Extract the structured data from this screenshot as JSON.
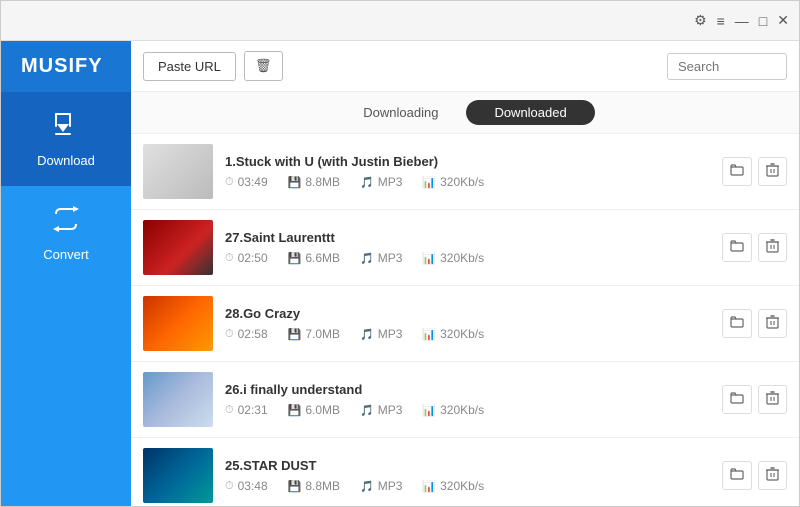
{
  "app": {
    "title": "MUSIFY"
  },
  "titlebar": {
    "settings_icon": "⚙",
    "menu_icon": "≡",
    "minimize_icon": "—",
    "maximize_icon": "□",
    "close_icon": "✕"
  },
  "toolbar": {
    "paste_url_label": "Paste URL",
    "delete_icon": "🗑",
    "search_placeholder": "Search"
  },
  "sidebar": {
    "items": [
      {
        "id": "download",
        "label": "Download",
        "icon": "⬇",
        "active": true
      },
      {
        "id": "convert",
        "label": "Convert",
        "icon": "🔄",
        "active": false
      }
    ]
  },
  "tabs": [
    {
      "id": "downloading",
      "label": "Downloading",
      "active": false
    },
    {
      "id": "downloaded",
      "label": "Downloaded",
      "active": true
    }
  ],
  "songs": [
    {
      "id": 1,
      "title": "1.Stuck with U (with Justin Bieber)",
      "duration": "03:49",
      "size": "8.8MB",
      "format": "MP3",
      "bitrate": "320Kb/s",
      "thumb_class": "thumb-1"
    },
    {
      "id": 2,
      "title": "27.Saint Laurenttt",
      "duration": "02:50",
      "size": "6.6MB",
      "format": "MP3",
      "bitrate": "320Kb/s",
      "thumb_class": "thumb-2"
    },
    {
      "id": 3,
      "title": "28.Go Crazy",
      "duration": "02:58",
      "size": "7.0MB",
      "format": "MP3",
      "bitrate": "320Kb/s",
      "thumb_class": "thumb-3"
    },
    {
      "id": 4,
      "title": "26.i finally understand",
      "duration": "02:31",
      "size": "6.0MB",
      "format": "MP3",
      "bitrate": "320Kb/s",
      "thumb_class": "thumb-4"
    },
    {
      "id": 5,
      "title": "25.STAR DUST",
      "duration": "03:48",
      "size": "8.8MB",
      "format": "MP3",
      "bitrate": "320Kb/s",
      "thumb_class": "thumb-5"
    }
  ]
}
